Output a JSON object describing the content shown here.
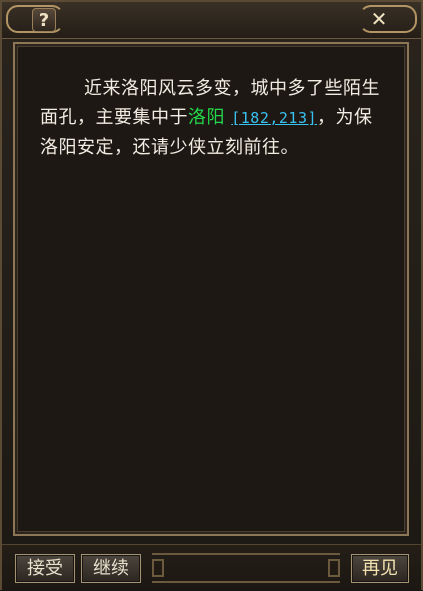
{
  "window": {
    "help_glyph": "?",
    "close_glyph": "✕"
  },
  "dialog": {
    "segments": [
      "近来洛阳风云多变，城中多了些陌生面孔，主要集中于",
      "洛阳",
      "[182,213]",
      "，为保洛阳安定，还请少侠立刻前往。"
    ],
    "location_name": "洛阳",
    "coordinates": "[182,213]"
  },
  "buttons": {
    "accept_label": "接受",
    "continue_label": "继续",
    "farewell_label": "再见"
  },
  "colors": {
    "location_green": "#22d84a",
    "link_blue": "#38c2f2",
    "text": "#f1ede2"
  }
}
